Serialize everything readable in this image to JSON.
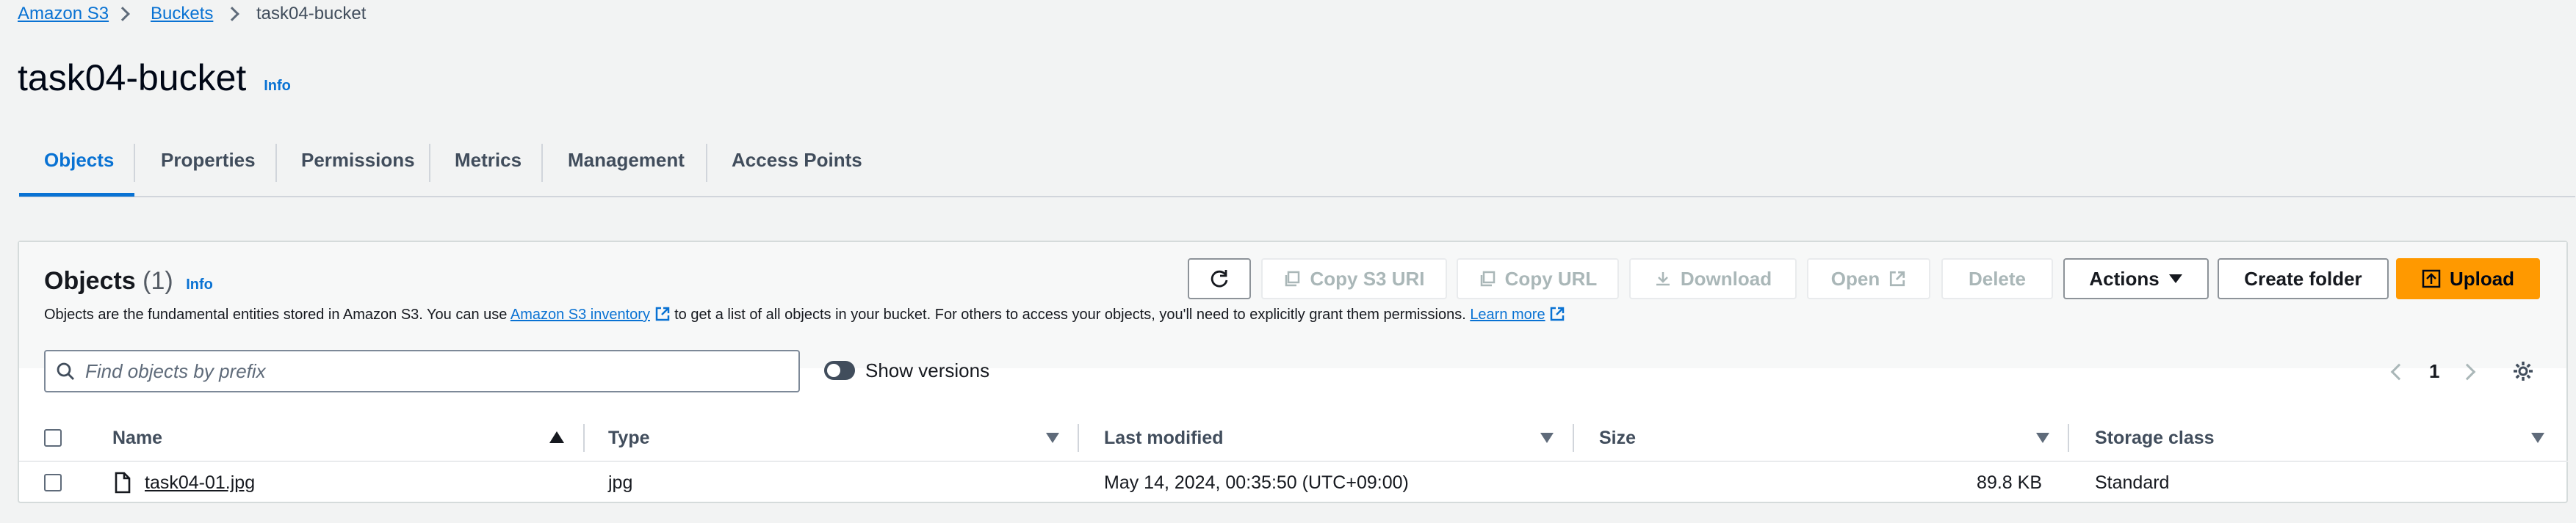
{
  "breadcrumb": {
    "items": [
      "Amazon S3",
      "Buckets",
      "task04-bucket"
    ]
  },
  "title": "task04-bucket",
  "info_label": "Info",
  "tabs": [
    "Objects",
    "Properties",
    "Permissions",
    "Metrics",
    "Management",
    "Access Points"
  ],
  "objects_panel": {
    "title": "Objects",
    "count": "(1)",
    "info_label": "Info",
    "description_1": "Objects are the fundamental entities stored in Amazon S3. You can use",
    "inventory_link": "Amazon S3 inventory",
    "description_2": "to get a list of all objects in your bucket. For others to access your objects, you'll need to explicitly grant them permissions.",
    "learn_more": "Learn more",
    "buttons": {
      "copy_s3_uri": "Copy S3 URI",
      "copy_url": "Copy URL",
      "download": "Download",
      "open": "Open",
      "delete": "Delete",
      "actions": "Actions",
      "create_folder": "Create folder",
      "upload": "Upload"
    },
    "search_placeholder": "Find objects by prefix",
    "show_versions_label": "Show versions",
    "page_number": "1"
  },
  "table": {
    "columns": [
      "Name",
      "Type",
      "Last modified",
      "Size",
      "Storage class"
    ],
    "rows": [
      {
        "name": "task04-01.jpg",
        "type": "jpg",
        "last_modified": "May 14, 2024, 00:35:50 (UTC+09:00)",
        "size": "89.8 KB",
        "storage_class": "Standard"
      }
    ]
  },
  "colors": {
    "link": "#0972d3",
    "primary_button": "#ff9900"
  }
}
